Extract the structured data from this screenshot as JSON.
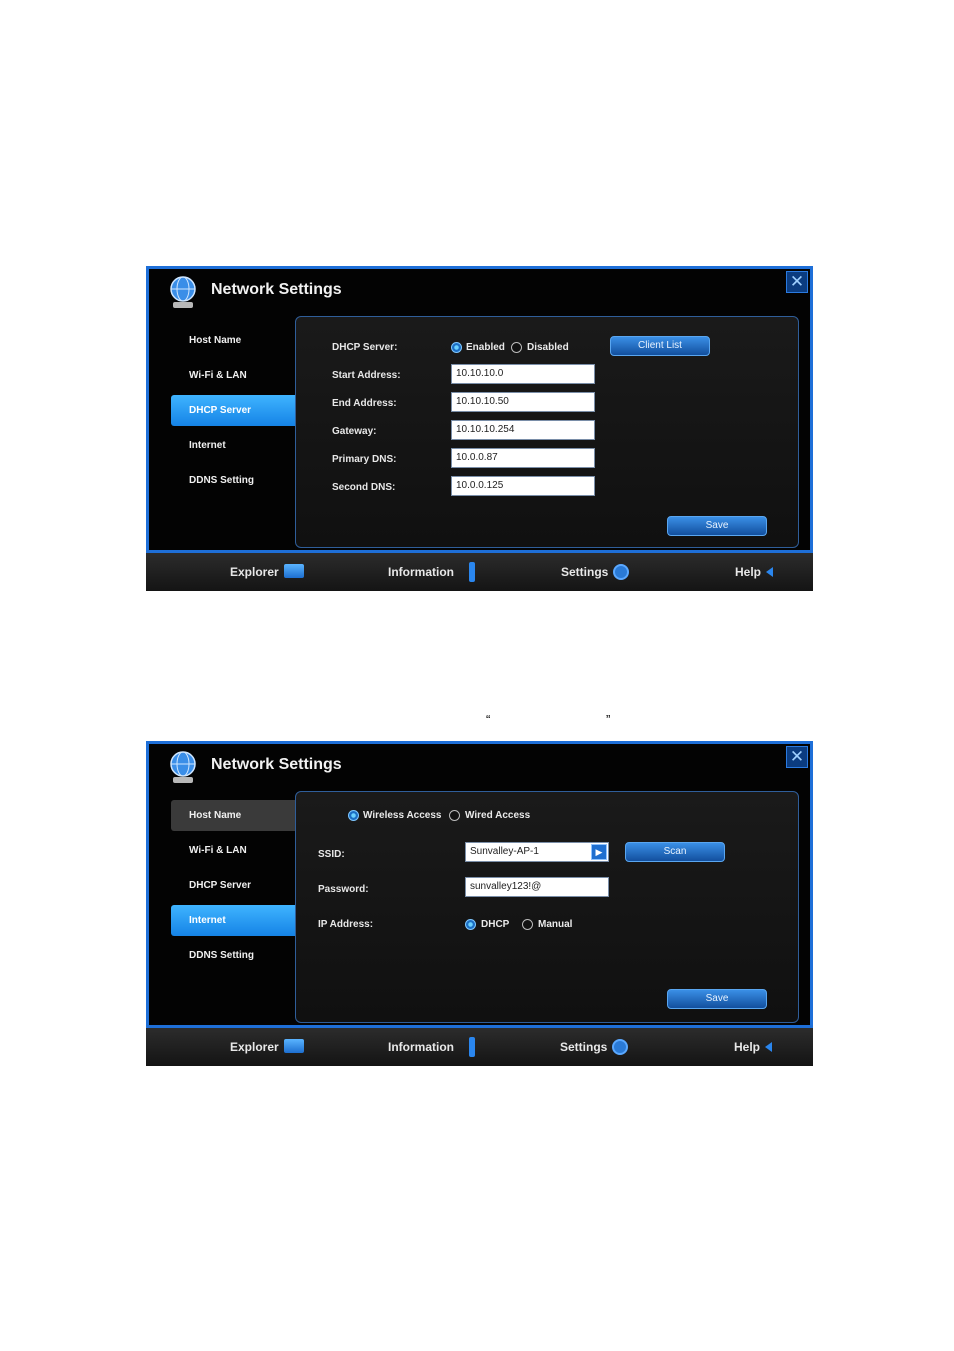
{
  "screen1": {
    "title": "Network Settings",
    "sidebar": [
      "Host Name",
      "Wi-Fi & LAN",
      "DHCP Server",
      "Internet",
      "DDNS Setting"
    ],
    "dhcp_label": "DHCP Server:",
    "enabled_label": "Enabled",
    "disabled_label": "Disabled",
    "client_list_label": "Client List",
    "start_label": "Start Address:",
    "start_value": "10.10.10.0",
    "end_label": "End Address:",
    "end_value": "10.10.10.50",
    "gateway_label": "Gateway:",
    "gateway_value": "10.10.10.254",
    "pdns_label": "Primary DNS:",
    "pdns_value": "10.0.0.87",
    "sdns_label": "Second DNS:",
    "sdns_value": "10.0.0.125",
    "save_label": "Save"
  },
  "quote_open": "“",
  "quote_close": "”",
  "screen2": {
    "title": "Network Settings",
    "sidebar": [
      "Host Name",
      "Wi-Fi & LAN",
      "DHCP Server",
      "Internet",
      "DDNS Setting"
    ],
    "wireless_label": "Wireless Access",
    "wired_label": "Wired Access",
    "ssid_label": "SSID:",
    "ssid_value": "Sunvalley-AP-1",
    "scan_label": "Scan",
    "password_label": "Password:",
    "password_value": "sunvalley123!@",
    "ip_label": "IP Address:",
    "dhcp_label": "DHCP",
    "manual_label": "Manual",
    "save_label": "Save"
  },
  "bottom_nav": [
    "Explorer",
    "Information",
    "Settings",
    "Help"
  ],
  "colors": {
    "accent": "#1e6fd8",
    "active_item": "#1583e6",
    "background": "#000000"
  }
}
